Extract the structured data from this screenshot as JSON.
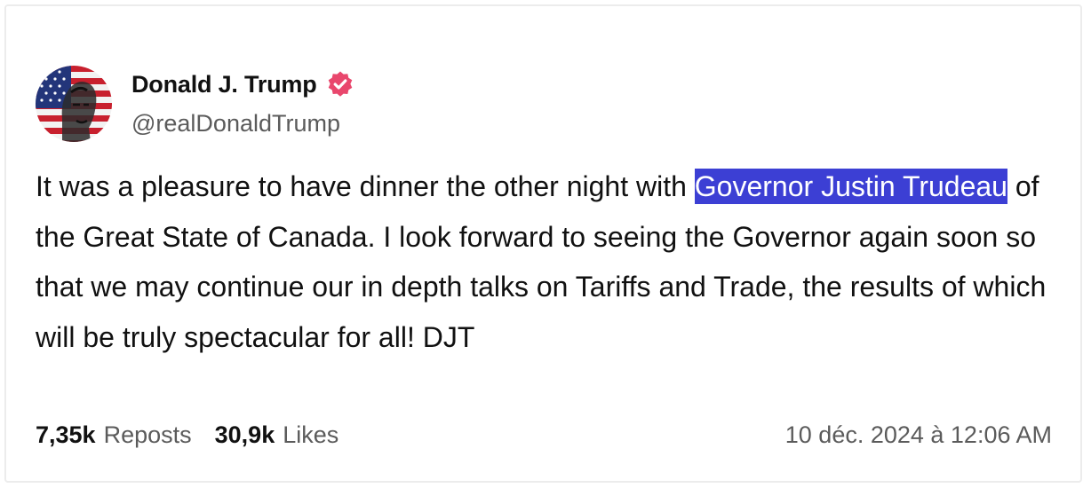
{
  "author": {
    "display_name": "Donald J. Trump",
    "handle": "@realDonaldTrump",
    "avatar_icon": "flag-portrait-avatar",
    "verified_icon": "verified-badge-icon",
    "verified_color": "#e9476d"
  },
  "post": {
    "text_before": "It was a pleasure to have dinner the other night with ",
    "mention": "Governor Justin Trudeau",
    "text_after": " of the Great State of Canada. I look forward to seeing the Governor again soon so that we may continue our in depth talks on Tariffs and Trade, the results of which will be truly spectacular for all! DJT",
    "highlight_color": "#3c3fd4"
  },
  "stats": {
    "reposts_count": "7,35k",
    "reposts_label": "Reposts",
    "likes_count": "30,9k",
    "likes_label": "Likes"
  },
  "timestamp": "10 déc. 2024 à 12:06 AM"
}
